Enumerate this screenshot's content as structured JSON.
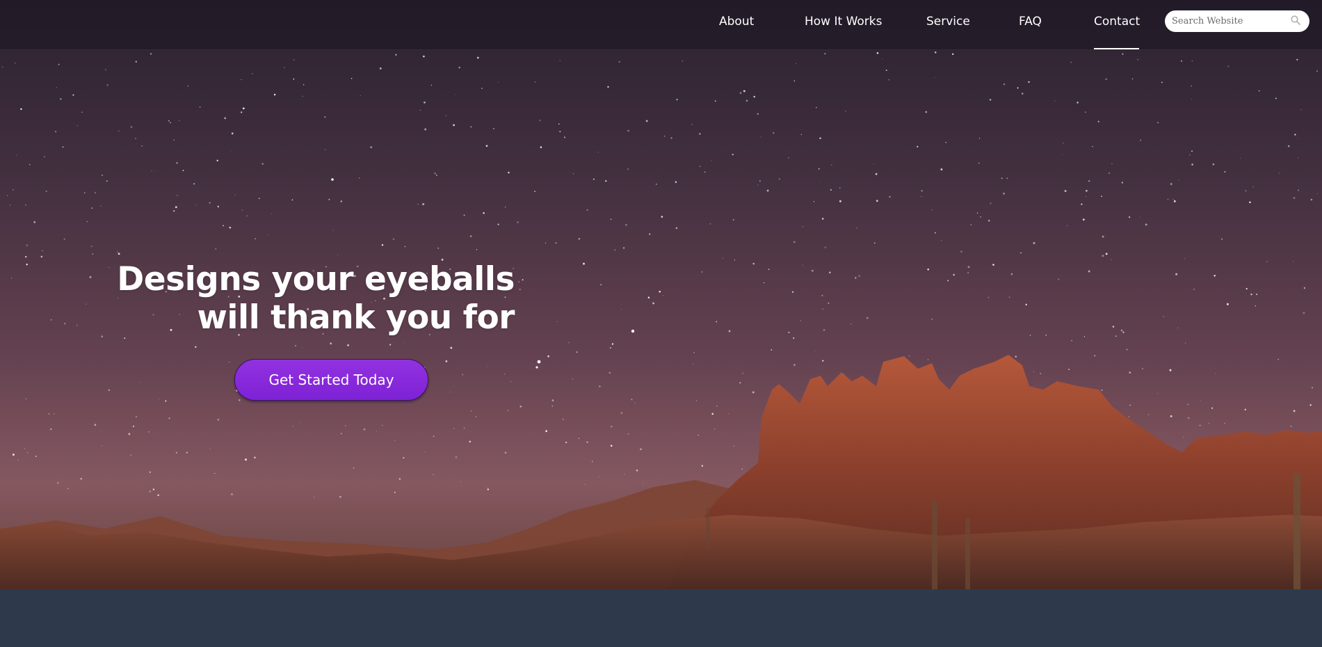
{
  "nav": {
    "items": [
      {
        "label": "About"
      },
      {
        "label": "How It Works"
      },
      {
        "label": "Service"
      },
      {
        "label": "FAQ"
      },
      {
        "label": "Contact"
      }
    ],
    "active_item": "Contact"
  },
  "search": {
    "placeholder": "Search Website",
    "icon": "search-icon"
  },
  "hero": {
    "headline_line1": "Designs your eyeballs",
    "headline_line2": "will thank you for",
    "cta_label": "Get Started Today",
    "background": "night sky with stars over red desert mountains"
  },
  "colors": {
    "accent": "#8a2be2",
    "nav_text": "#ffffff",
    "bottom_band": "#2e3a4c"
  }
}
